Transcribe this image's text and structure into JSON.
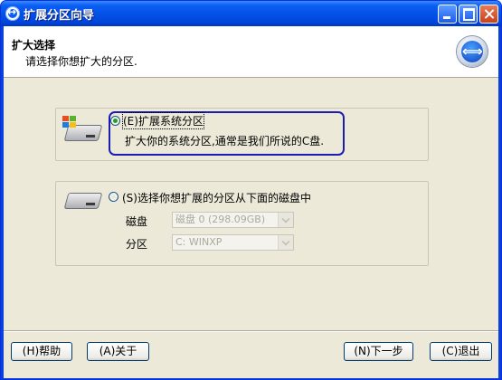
{
  "window": {
    "title": "扩展分区向导"
  },
  "header": {
    "title": "扩大选择",
    "subtitle": "请选择你想扩大的分区."
  },
  "option1": {
    "label": "(E)扩展系统分区",
    "description": "扩大你的系统分区,通常是我们所说的C盘.",
    "selected": true
  },
  "option2": {
    "label": "(S)选择你想扩展的分区从下面的磁盘中",
    "selected": false,
    "disk_label": "磁盘",
    "disk_value": "磁盘 0 (298.09GB)",
    "partition_label": "分区",
    "partition_value": "C: WINXP"
  },
  "buttons": {
    "help": "(H)帮助",
    "about": "(A)关于",
    "next": "(N)下一步",
    "exit": "(C)退出"
  },
  "colors": {
    "titlebar": "#0a5ff2",
    "client_bg": "#ece9d8",
    "focus_ring": "#1b1bb5",
    "radio_dot": "#21a121"
  },
  "icons": [
    "wizard-app-icon",
    "minimize-icon",
    "maximize-icon",
    "close-icon",
    "resize-arrows-icon",
    "system-disk-icon",
    "disk-icon",
    "windows-flag-icon"
  ]
}
